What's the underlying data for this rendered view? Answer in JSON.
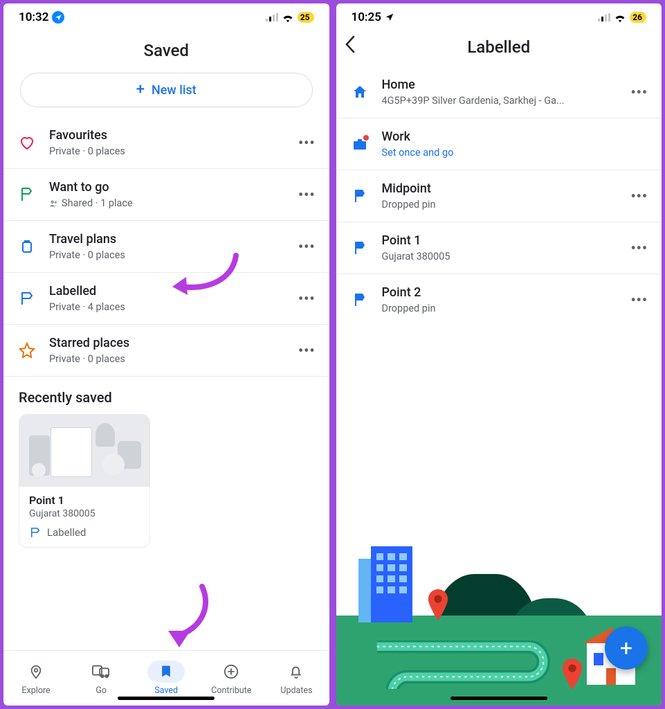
{
  "left": {
    "status": {
      "time": "10:32",
      "battery": "25"
    },
    "title": "Saved",
    "new_list": "New list",
    "lists": [
      {
        "title": "Favourites",
        "sub": "Private · 0 places"
      },
      {
        "title": "Want to go",
        "sub": "Shared · 1 place"
      },
      {
        "title": "Travel plans",
        "sub": "Private · 0 places"
      },
      {
        "title": "Labelled",
        "sub": "Private · 4 places"
      },
      {
        "title": "Starred places",
        "sub": "Private · 0 places"
      }
    ],
    "recently_saved_title": "Recently saved",
    "recent": {
      "title": "Point 1",
      "sub": "Gujarat 380005",
      "tag": "Labelled"
    },
    "nav": [
      {
        "label": "Explore"
      },
      {
        "label": "Go"
      },
      {
        "label": "Saved"
      },
      {
        "label": "Contribute"
      },
      {
        "label": "Updates"
      }
    ]
  },
  "right": {
    "status": {
      "time": "10:25",
      "battery": "26"
    },
    "title": "Labelled",
    "items": [
      {
        "title": "Home",
        "sub": "4G5P+39P Silver Gardenia, Sarkhej - Ga..."
      },
      {
        "title": "Work",
        "sub": "Set once and go"
      },
      {
        "title": "Midpoint",
        "sub": "Dropped pin"
      },
      {
        "title": "Point 1",
        "sub": "Gujarat 380005"
      },
      {
        "title": "Point 2",
        "sub": "Dropped pin"
      }
    ]
  }
}
